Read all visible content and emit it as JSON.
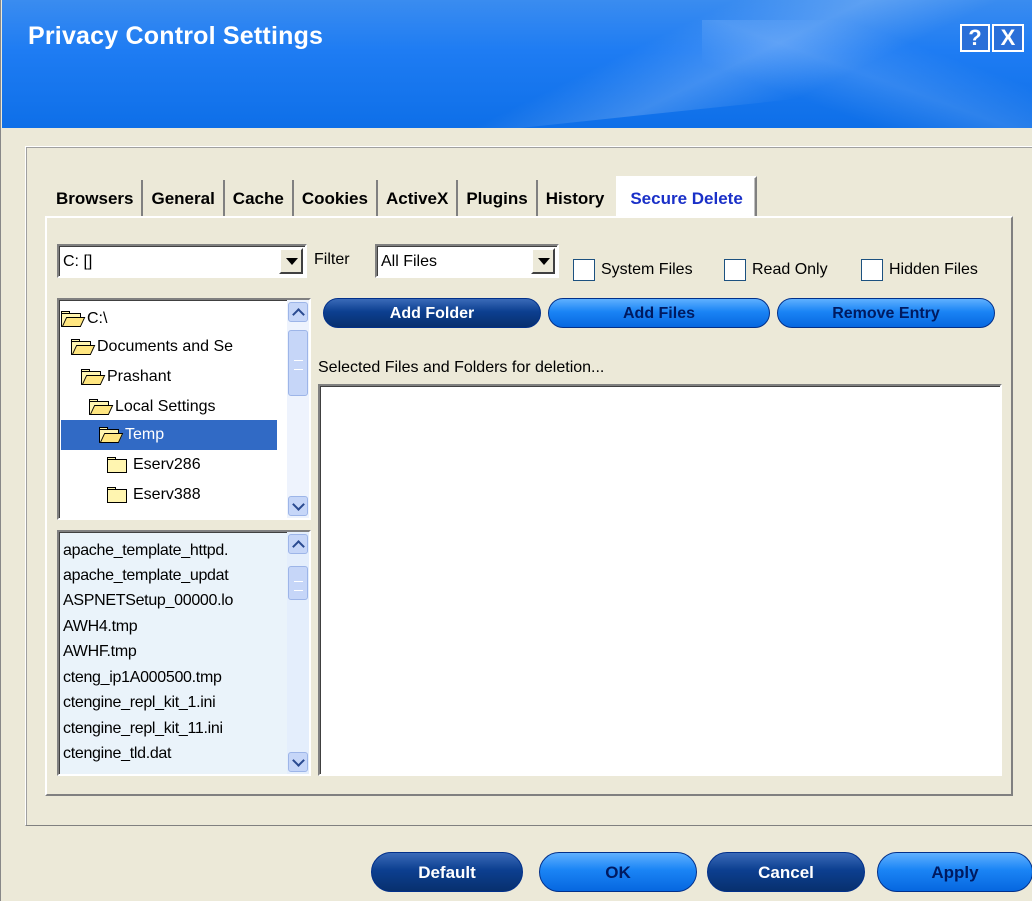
{
  "window": {
    "title": "Privacy Control Settings",
    "help_glyph": "?",
    "close_glyph": "X"
  },
  "tabs": [
    {
      "label": "Browsers"
    },
    {
      "label": "General"
    },
    {
      "label": "Cache"
    },
    {
      "label": "Cookies"
    },
    {
      "label": "ActiveX"
    },
    {
      "label": "Plugins"
    },
    {
      "label": "History"
    },
    {
      "label": "Secure Delete",
      "active": true
    }
  ],
  "secure_delete": {
    "drive_value": "C: []",
    "filter_label": "Filter",
    "filter_value": "All Files",
    "checkboxes": {
      "system_files": "System Files",
      "read_only": "Read Only",
      "hidden_files": "Hidden Files"
    },
    "tree": {
      "items": [
        {
          "label": "C:\\",
          "open": true
        },
        {
          "label": "Documents and Se",
          "open": true
        },
        {
          "label": "Prashant",
          "open": true
        },
        {
          "label": "Local Settings",
          "open": true
        },
        {
          "label": "Temp",
          "open": true,
          "selected": true
        },
        {
          "label": "Eserv286",
          "open": false
        },
        {
          "label": "Eserv388",
          "open": false
        }
      ]
    },
    "files": [
      "apache_template_httpd.",
      "apache_template_updat",
      "ASPNETSetup_00000.lo",
      "AWH4.tmp",
      "AWHF.tmp",
      "cteng_ip1A000500.tmp",
      "ctengine_repl_kit_1.ini",
      "ctengine_repl_kit_11.ini",
      "ctengine_tld.dat"
    ],
    "buttons": {
      "add_folder": "Add Folder",
      "add_files": "Add Files",
      "remove_entry": "Remove Entry"
    },
    "selected_label": "Selected Files and Folders for deletion..."
  },
  "footer": {
    "default": "Default",
    "ok": "OK",
    "cancel": "Cancel",
    "apply": "Apply"
  },
  "colors": {
    "banner": "#1e7cf3",
    "active_tab_text": "#1a30c8",
    "selection": "#316ac5"
  }
}
